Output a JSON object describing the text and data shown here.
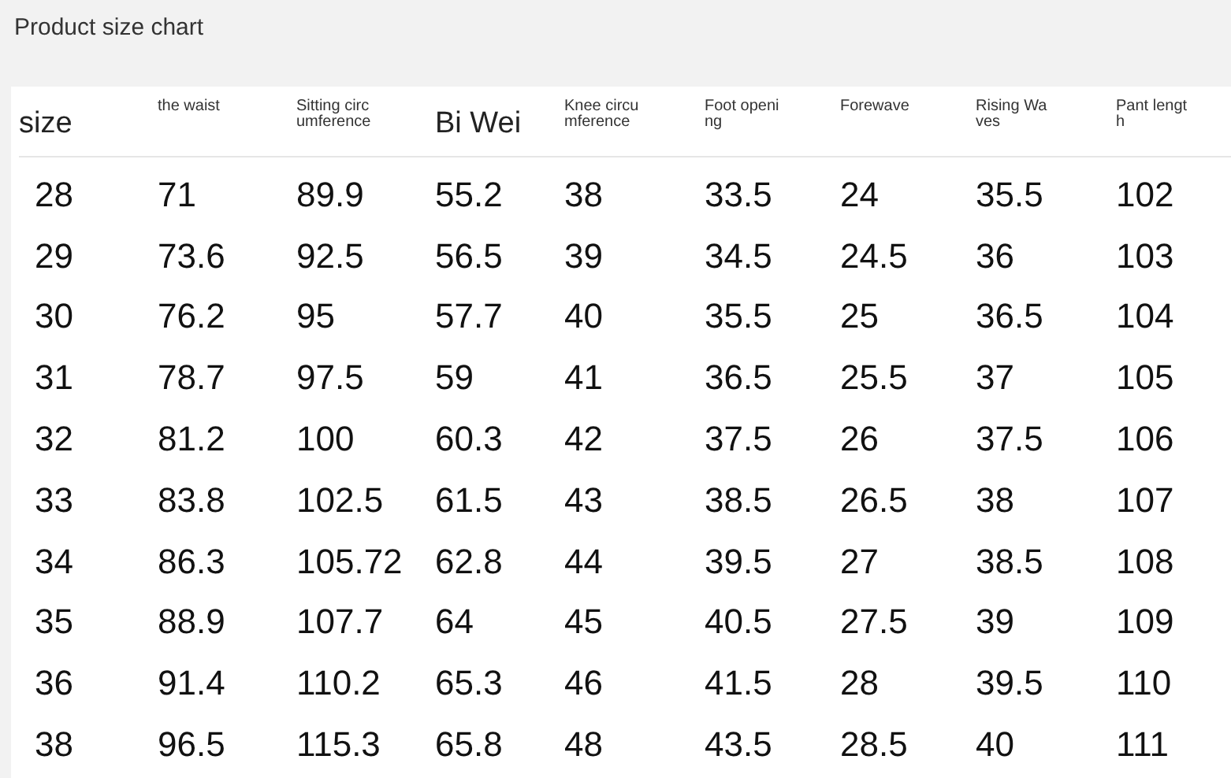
{
  "title": "Product size chart",
  "table": {
    "columns": [
      {
        "label": "size",
        "kind": "large"
      },
      {
        "label": "the waist",
        "kind": "small"
      },
      {
        "label": "Sitting circumference",
        "kind": "small"
      },
      {
        "label": "Bi Wei",
        "kind": "large"
      },
      {
        "label": "Knee circumference",
        "kind": "small"
      },
      {
        "label": "Foot opening",
        "kind": "small"
      },
      {
        "label": "Forewave",
        "kind": "small"
      },
      {
        "label": "Rising Waves",
        "kind": "small"
      },
      {
        "label": "Pant length",
        "kind": "small"
      }
    ],
    "rows": [
      [
        "28",
        "71",
        "89.9",
        "55.2",
        "38",
        "33.5",
        "24",
        "35.5",
        "102"
      ],
      [
        "29",
        "73.6",
        "92.5",
        "56.5",
        "39",
        "34.5",
        "24.5",
        "36",
        "103"
      ],
      [
        "30",
        "76.2",
        "95",
        "57.7",
        "40",
        "35.5",
        "25",
        "36.5",
        "104"
      ],
      [
        "31",
        "78.7",
        "97.5",
        "59",
        "41",
        "36.5",
        "25.5",
        "37",
        "105"
      ],
      [
        "32",
        "81.2",
        "100",
        "60.3",
        "42",
        "37.5",
        "26",
        "37.5",
        "106"
      ],
      [
        "33",
        "83.8",
        "102.5",
        "61.5",
        "43",
        "38.5",
        "26.5",
        "38",
        "107"
      ],
      [
        "34",
        "86.3",
        "105.72",
        "62.8",
        "44",
        "39.5",
        "27",
        "38.5",
        "108"
      ],
      [
        "35",
        "88.9",
        "107.7",
        "64",
        "45",
        "40.5",
        "27.5",
        "39",
        "109"
      ],
      [
        "36",
        "91.4",
        "110.2",
        "65.3",
        "46",
        "41.5",
        "28",
        "39.5",
        "110"
      ],
      [
        "38",
        "96.5",
        "115.3",
        "65.8",
        "48",
        "43.5",
        "28.5",
        "40",
        "111"
      ]
    ]
  }
}
